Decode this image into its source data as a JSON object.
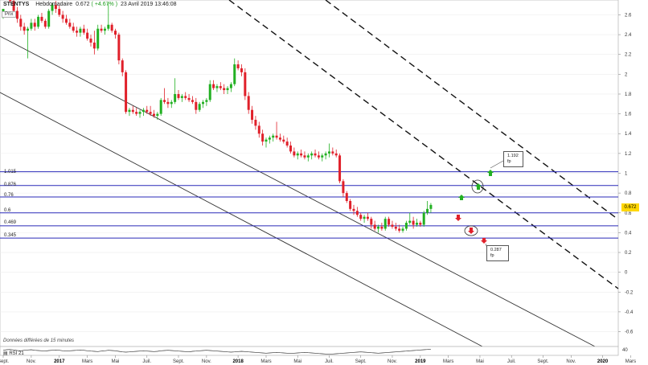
{
  "header": {
    "symbol": "STENTYS",
    "period": "Hebdomadaire",
    "price": "0.672",
    "change": "( +4.67% )",
    "timestamp": "23 Avril 2019 13:46:08"
  },
  "price_label": "Prix",
  "footer_note": "Données différées de 15 minutes",
  "rsi_label": "RSI 21",
  "rsi_axis_label": "40",
  "last_price_tag": "0.672",
  "targets": [
    {
      "price": "1.192",
      "unit": "fp"
    },
    {
      "price": "0.287",
      "unit": "fp"
    }
  ],
  "colors": {
    "up": "#22b022",
    "down": "#e0202a",
    "level": "#2a2ab8",
    "price_tag": "#ffd700"
  },
  "chart_data": {
    "type": "candlestick",
    "ylim": [
      -0.75,
      2.75
    ],
    "y_ticks": [
      "2.6",
      "2.4",
      "2.2",
      "2",
      "1.8",
      "1.6",
      "1.4",
      "1.2",
      "1",
      "0.8",
      "0.6",
      "0.4",
      "0.2",
      "0",
      "-0.2",
      "-0.4",
      "-0.6"
    ],
    "x_ticks": [
      {
        "label": "Sept.",
        "i": 0
      },
      {
        "label": "Nov.",
        "i": 8
      },
      {
        "label": "2017",
        "i": 16,
        "year": true
      },
      {
        "label": "Mars",
        "i": 24
      },
      {
        "label": "Mai",
        "i": 32
      },
      {
        "label": "Juil.",
        "i": 41
      },
      {
        "label": "Sept.",
        "i": 50
      },
      {
        "label": "Nov.",
        "i": 58
      },
      {
        "label": "2018",
        "i": 67,
        "year": true
      },
      {
        "label": "Mars",
        "i": 75
      },
      {
        "label": "Mai",
        "i": 84
      },
      {
        "label": "Juil.",
        "i": 93
      },
      {
        "label": "Sept.",
        "i": 102
      },
      {
        "label": "Nov.",
        "i": 111
      },
      {
        "label": "2019",
        "i": 119,
        "year": true
      },
      {
        "label": "Mars",
        "i": 127
      },
      {
        "label": "Mai",
        "i": 136
      },
      {
        "label": "Juil.",
        "i": 145
      },
      {
        "label": "Sept.",
        "i": 154
      },
      {
        "label": "Nov.",
        "i": 162
      },
      {
        "label": "2020",
        "i": 171,
        "year": true
      },
      {
        "label": "Mars",
        "i": 179
      }
    ],
    "levels": [
      1.015,
      0.876,
      0.76,
      0.6,
      0.469,
      0.345
    ],
    "level_labels": [
      "1.015",
      "0.876",
      "0.76",
      "0.6",
      "0.469",
      "0.345"
    ],
    "candles": [
      [
        2.62,
        2.66,
        2.56,
        2.66
      ],
      [
        2.86,
        2.92,
        2.8,
        2.84
      ],
      [
        2.84,
        2.88,
        2.72,
        2.74
      ],
      [
        2.74,
        2.78,
        2.6,
        2.64
      ],
      [
        2.64,
        2.68,
        2.52,
        2.56
      ],
      [
        2.56,
        2.6,
        2.44,
        2.48
      ],
      [
        2.48,
        2.52,
        2.4,
        2.44
      ],
      [
        2.44,
        2.48,
        2.16,
        2.46
      ],
      [
        2.46,
        2.56,
        2.44,
        2.52
      ],
      [
        2.52,
        2.56,
        2.44,
        2.48
      ],
      [
        2.48,
        2.6,
        2.46,
        2.58
      ],
      [
        2.58,
        2.62,
        2.52,
        2.54
      ],
      [
        2.54,
        2.56,
        2.46,
        2.48
      ],
      [
        2.48,
        2.66,
        2.46,
        2.64
      ],
      [
        2.64,
        2.72,
        2.6,
        2.7
      ],
      [
        2.7,
        2.74,
        2.62,
        2.66
      ],
      [
        2.66,
        2.7,
        2.58,
        2.6
      ],
      [
        2.6,
        2.64,
        2.52,
        2.56
      ],
      [
        2.56,
        2.6,
        2.5,
        2.52
      ],
      [
        2.52,
        2.56,
        2.46,
        2.48
      ],
      [
        2.48,
        2.52,
        2.42,
        2.44
      ],
      [
        2.44,
        2.48,
        2.38,
        2.42
      ],
      [
        2.42,
        2.48,
        2.38,
        2.46
      ],
      [
        2.46,
        2.5,
        2.4,
        2.42
      ],
      [
        2.42,
        2.46,
        2.34,
        2.36
      ],
      [
        2.36,
        2.4,
        2.28,
        2.32
      ],
      [
        2.32,
        2.44,
        2.2,
        2.26
      ],
      [
        2.26,
        2.5,
        2.24,
        2.46
      ],
      [
        2.46,
        2.5,
        2.42,
        2.44
      ],
      [
        2.44,
        2.48,
        2.4,
        2.46
      ],
      [
        2.46,
        2.72,
        2.44,
        2.5
      ],
      [
        2.5,
        2.52,
        2.42,
        2.44
      ],
      [
        2.44,
        2.46,
        2.36,
        2.4
      ],
      [
        2.4,
        2.42,
        2.1,
        2.14
      ],
      [
        2.14,
        2.16,
        1.98,
        2.02
      ],
      [
        2.02,
        2.04,
        1.6,
        1.62
      ],
      [
        1.62,
        1.66,
        1.58,
        1.64
      ],
      [
        1.64,
        1.68,
        1.6,
        1.62
      ],
      [
        1.62,
        1.66,
        1.58,
        1.6
      ],
      [
        1.6,
        1.64,
        1.56,
        1.62
      ],
      [
        1.62,
        1.66,
        1.58,
        1.64
      ],
      [
        1.64,
        1.68,
        1.6,
        1.62
      ],
      [
        1.62,
        1.68,
        1.58,
        1.6
      ],
      [
        1.6,
        1.64,
        1.56,
        1.58
      ],
      [
        1.58,
        1.62,
        1.54,
        1.6
      ],
      [
        1.6,
        1.76,
        1.58,
        1.74
      ],
      [
        1.74,
        1.86,
        1.7,
        1.72
      ],
      [
        1.72,
        1.76,
        1.66,
        1.7
      ],
      [
        1.7,
        1.74,
        1.66,
        1.72
      ],
      [
        1.72,
        1.96,
        1.7,
        1.8
      ],
      [
        1.8,
        1.84,
        1.74,
        1.76
      ],
      [
        1.76,
        1.8,
        1.72,
        1.78
      ],
      [
        1.78,
        1.82,
        1.74,
        1.76
      ],
      [
        1.76,
        1.8,
        1.72,
        1.74
      ],
      [
        1.74,
        1.78,
        1.7,
        1.72
      ],
      [
        1.72,
        1.76,
        1.6,
        1.64
      ],
      [
        1.64,
        1.72,
        1.62,
        1.7
      ],
      [
        1.7,
        1.74,
        1.66,
        1.72
      ],
      [
        1.72,
        1.76,
        1.68,
        1.74
      ],
      [
        1.74,
        1.94,
        1.72,
        1.9
      ],
      [
        1.9,
        1.94,
        1.84,
        1.86
      ],
      [
        1.86,
        1.9,
        1.82,
        1.88
      ],
      [
        1.88,
        1.92,
        1.84,
        1.86
      ],
      [
        1.86,
        1.9,
        1.8,
        1.84
      ],
      [
        1.84,
        1.88,
        1.8,
        1.86
      ],
      [
        1.86,
        1.92,
        1.82,
        1.9
      ],
      [
        1.9,
        2.16,
        1.88,
        2.1
      ],
      [
        2.1,
        2.14,
        2.04,
        2.06
      ],
      [
        2.06,
        2.1,
        1.98,
        2.02
      ],
      [
        2.02,
        2.06,
        1.74,
        1.78
      ],
      [
        1.78,
        1.82,
        1.6,
        1.64
      ],
      [
        1.64,
        1.68,
        1.5,
        1.54
      ],
      [
        1.54,
        1.58,
        1.44,
        1.48
      ],
      [
        1.48,
        1.52,
        1.36,
        1.4
      ],
      [
        1.4,
        1.44,
        1.28,
        1.32
      ],
      [
        1.32,
        1.36,
        1.26,
        1.34
      ],
      [
        1.34,
        1.38,
        1.3,
        1.36
      ],
      [
        1.36,
        1.4,
        1.32,
        1.38
      ],
      [
        1.38,
        1.52,
        1.34,
        1.36
      ],
      [
        1.36,
        1.4,
        1.32,
        1.34
      ],
      [
        1.34,
        1.38,
        1.3,
        1.32
      ],
      [
        1.32,
        1.36,
        1.26,
        1.28
      ],
      [
        1.28,
        1.32,
        1.2,
        1.22
      ],
      [
        1.22,
        1.26,
        1.16,
        1.18
      ],
      [
        1.18,
        1.22,
        1.14,
        1.2
      ],
      [
        1.2,
        1.24,
        1.16,
        1.18
      ],
      [
        1.18,
        1.22,
        1.14,
        1.16
      ],
      [
        1.16,
        1.2,
        1.12,
        1.18
      ],
      [
        1.18,
        1.22,
        1.14,
        1.2
      ],
      [
        1.2,
        1.24,
        1.16,
        1.18
      ],
      [
        1.18,
        1.22,
        1.14,
        1.16
      ],
      [
        1.16,
        1.2,
        1.12,
        1.18
      ],
      [
        1.18,
        1.22,
        1.14,
        1.2
      ],
      [
        1.2,
        1.3,
        1.16,
        1.22
      ],
      [
        1.22,
        1.26,
        1.18,
        1.2
      ],
      [
        1.2,
        1.24,
        1.16,
        1.18
      ],
      [
        1.18,
        1.2,
        0.9,
        0.92
      ],
      [
        0.92,
        0.94,
        0.76,
        0.8
      ],
      [
        0.8,
        0.82,
        0.7,
        0.72
      ],
      [
        0.72,
        0.74,
        0.62,
        0.64
      ],
      [
        0.64,
        0.68,
        0.58,
        0.62
      ],
      [
        0.62,
        0.66,
        0.56,
        0.58
      ],
      [
        0.58,
        0.6,
        0.52,
        0.54
      ],
      [
        0.54,
        0.58,
        0.5,
        0.56
      ],
      [
        0.56,
        0.6,
        0.52,
        0.54
      ],
      [
        0.54,
        0.56,
        0.44,
        0.48
      ],
      [
        0.48,
        0.52,
        0.42,
        0.44
      ],
      [
        0.44,
        0.48,
        0.4,
        0.46
      ],
      [
        0.46,
        0.5,
        0.42,
        0.44
      ],
      [
        0.44,
        0.56,
        0.42,
        0.54
      ],
      [
        0.54,
        0.56,
        0.46,
        0.48
      ],
      [
        0.48,
        0.52,
        0.44,
        0.46
      ],
      [
        0.46,
        0.5,
        0.42,
        0.44
      ],
      [
        0.44,
        0.48,
        0.4,
        0.42
      ],
      [
        0.42,
        0.46,
        0.4,
        0.44
      ],
      [
        0.44,
        0.52,
        0.42,
        0.5
      ],
      [
        0.5,
        0.6,
        0.48,
        0.52
      ],
      [
        0.52,
        0.56,
        0.44,
        0.48
      ],
      [
        0.48,
        0.54,
        0.46,
        0.5
      ],
      [
        0.5,
        0.52,
        0.46,
        0.48
      ],
      [
        0.48,
        0.62,
        0.46,
        0.6
      ],
      [
        0.6,
        0.72,
        0.58,
        0.64
      ],
      [
        0.64,
        0.7,
        0.6,
        0.68
      ]
    ],
    "rsi": [
      44,
      46,
      47,
      45,
      43,
      42,
      44,
      45,
      46,
      44,
      43,
      42,
      41,
      43,
      44,
      45,
      44,
      42,
      41,
      42,
      43,
      44,
      45,
      44,
      42,
      41,
      40,
      39,
      41,
      42,
      44,
      43,
      42,
      40,
      38,
      37,
      38,
      39,
      40,
      41,
      42,
      41,
      40,
      39,
      40,
      42,
      43,
      44,
      43,
      42,
      41,
      40,
      39,
      38,
      40,
      41,
      42,
      43,
      44,
      43,
      42,
      41,
      40,
      39,
      38,
      37,
      38,
      39,
      40,
      39,
      38,
      37,
      36,
      35,
      34,
      33,
      34,
      35,
      36,
      35,
      34,
      33,
      32,
      33,
      34,
      35,
      36,
      35,
      34,
      33,
      32,
      31,
      30,
      29,
      30,
      31,
      32,
      33,
      34,
      35,
      36,
      37,
      38,
      37,
      36,
      35,
      34,
      33,
      34,
      35,
      36,
      37,
      38,
      39,
      40,
      41,
      42,
      43,
      44,
      45,
      46,
      47,
      48
    ]
  }
}
